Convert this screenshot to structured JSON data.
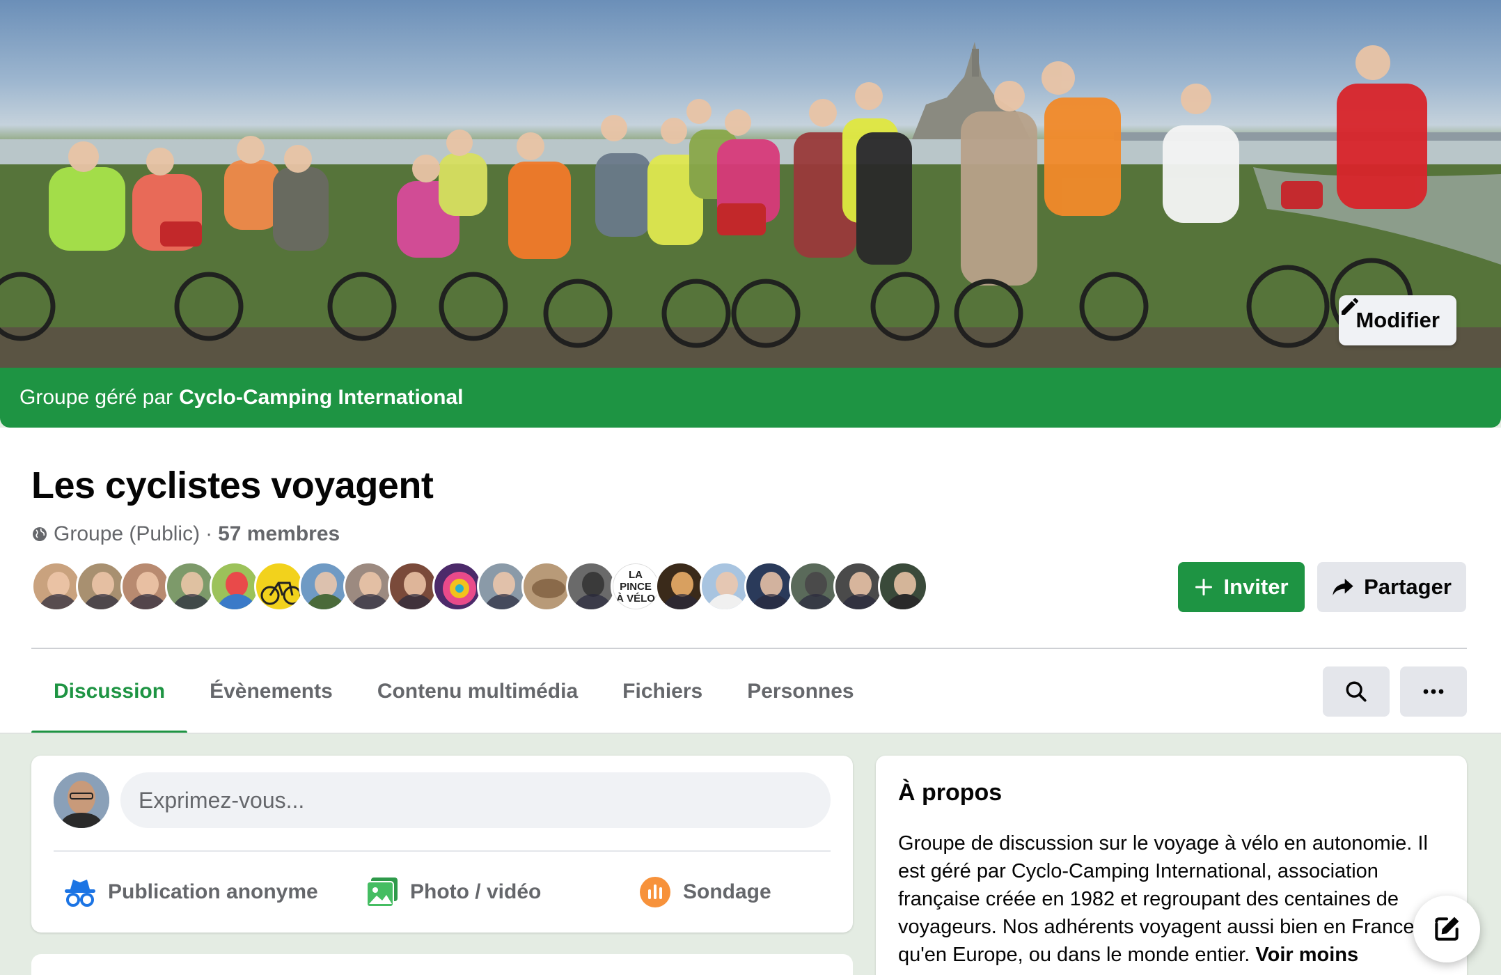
{
  "cover": {
    "edit_label": "Modifier",
    "managed_prefix": "Groupe géré par",
    "managed_by": "Cyclo-Camping International"
  },
  "group": {
    "name": "Les cyclistes voyagent",
    "privacy": "Groupe (Public)",
    "separator": "·",
    "members": "57 membres"
  },
  "member_avatars": {
    "text_avatar": "LA PINCE À VÉLO",
    "colors": [
      "#c9a27e",
      "#a89070",
      "#b88a70",
      "#7d9a6a",
      "#9cc25a",
      "#f2d21c",
      "#6f9ac4",
      "#9c8a80",
      "#7a4a3a",
      "#4c2a6a",
      "#8a9aa8",
      "#b89a78",
      "#6a6a6a",
      "#ffffff",
      "#3a2a1a",
      "#a8c4e0",
      "#2a3a5a",
      "#5a6a5a",
      "#4a4a4a",
      "#3a4a3a"
    ]
  },
  "actions": {
    "invite_label": "Inviter",
    "share_label": "Partager"
  },
  "tabs": [
    {
      "label": "Discussion",
      "active": true
    },
    {
      "label": "Évènements",
      "active": false
    },
    {
      "label": "Contenu multimédia",
      "active": false
    },
    {
      "label": "Fichiers",
      "active": false
    },
    {
      "label": "Personnes",
      "active": false
    }
  ],
  "composer": {
    "placeholder": "Exprimez-vous...",
    "actions": [
      {
        "label": "Publication anonyme",
        "icon": "incognito-icon",
        "color": "#1b74e4"
      },
      {
        "label": "Photo / vidéo",
        "icon": "photo-icon",
        "color": "#45bd62"
      },
      {
        "label": "Sondage",
        "icon": "poll-icon",
        "color": "#f7923b"
      }
    ]
  },
  "about": {
    "title": "À propos",
    "text": "Groupe de discussion sur le voyage à vélo en autonomie. Il est géré par Cyclo-Camping International, association française créée en 1982 et regroupant des centaines de voyageurs. Nos adhérents voyagent aussi bien en France qu'en Europe, ou dans le monde entier.",
    "more_label": "Voir moins"
  },
  "colors": {
    "brand_green": "#1e9443",
    "page_bg": "#e4ece3"
  }
}
